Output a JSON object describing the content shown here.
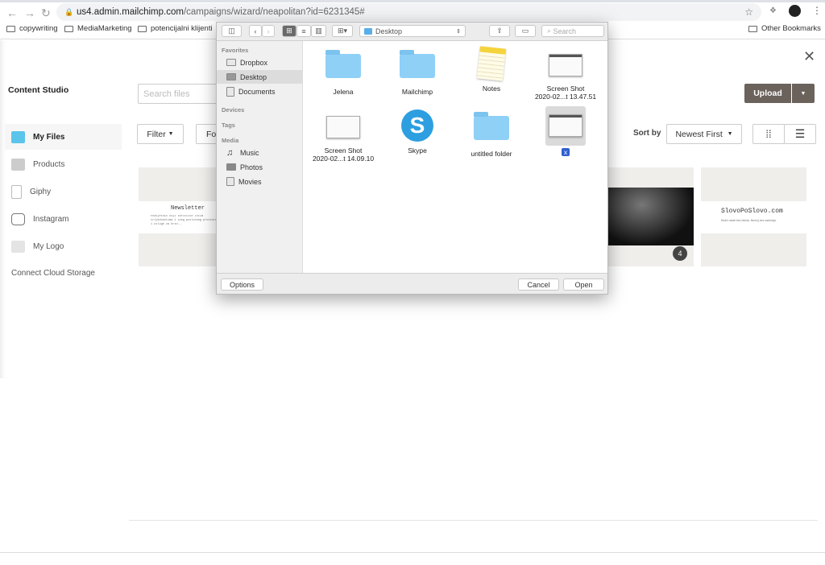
{
  "browser": {
    "url_host": "us4.admin.mailchimp.com",
    "url_path": "/campaigns/wizard/neapolitan?id=6231345#",
    "bookmarks": [
      "copywriting",
      "MediaMarketing",
      "potencijalni klijenti"
    ],
    "other_bookmarks": "Other Bookmarks"
  },
  "studio": {
    "title": "Content Studio",
    "search_placeholder": "Search files",
    "nav": [
      {
        "label": "My Files",
        "icon": "my-files-icon"
      },
      {
        "label": "Products",
        "icon": "tshirt-icon"
      },
      {
        "label": "Giphy",
        "icon": "file-icon"
      },
      {
        "label": "Instagram",
        "icon": "instagram-icon"
      },
      {
        "label": "My Logo",
        "icon": "image-icon"
      }
    ],
    "connect": "Connect Cloud Storage",
    "filter": "Filter",
    "folders_partial": "Fo",
    "upload": "Upload",
    "sort_by": "Sort by",
    "sort_value": "Newest First",
    "cards": [
      {
        "title": "Newsletter",
        "text": "Podsjetnik koji koristite istim vrijednostima i svog poslovnog prostora i usluge za brzo..."
      },
      {
        "badge": "4"
      },
      {
        "title": "SlovoPoSlovo.com",
        "text": "Može ostati bez teksta. Nemoj bez sadržaja."
      }
    ],
    "accent": "#6b625c"
  },
  "dialog": {
    "location": "Desktop",
    "search_placeholder": "Search",
    "sections": {
      "favorites": "Favorites",
      "devices": "Devices",
      "tags": "Tags",
      "media": "Media"
    },
    "favorites": [
      "Dropbox",
      "Desktop",
      "Documents"
    ],
    "media": [
      "Music",
      "Photos",
      "Movies"
    ],
    "files": [
      {
        "name": "Jelena",
        "kind": "folder"
      },
      {
        "name": "Mailchimp",
        "kind": "folder"
      },
      {
        "name": "Notes",
        "kind": "notes"
      },
      {
        "name": "Screen Shot",
        "name2": "2020-02...t 13.47.51",
        "kind": "screenshot"
      },
      {
        "name": "Screen Shot",
        "name2": "2020-02...t 14.09.10",
        "kind": "screenshot"
      },
      {
        "name": "Skype",
        "kind": "skype"
      },
      {
        "name": "untitled folder",
        "kind": "folder"
      },
      {
        "name": "x",
        "kind": "screenshot",
        "selected": true
      }
    ],
    "options": "Options",
    "cancel": "Cancel",
    "open": "Open"
  }
}
